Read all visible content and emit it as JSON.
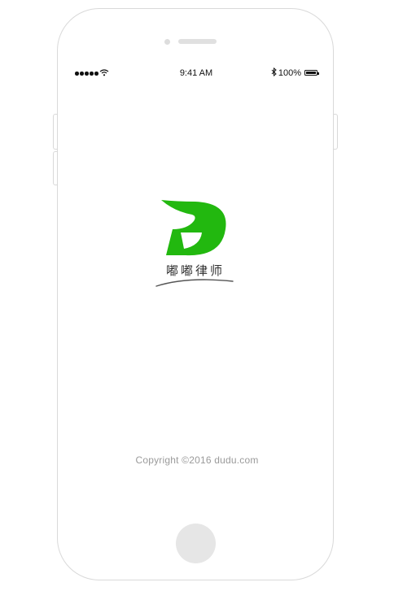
{
  "status_bar": {
    "time": "9:41 AM",
    "battery": "100%"
  },
  "splash": {
    "logo_letter": "D",
    "brand_name": "嘟嘟律师",
    "copyright": "Copyright ©2016  dudu.com"
  },
  "colors": {
    "brand_green": "#22b80f",
    "text_gray": "#9a9a9a"
  }
}
